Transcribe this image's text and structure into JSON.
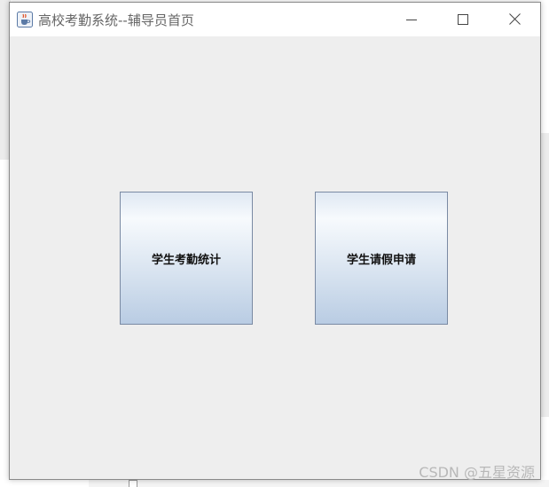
{
  "window": {
    "title": "高校考勤系统--辅导员首页",
    "app_icon": "java-cup-icon",
    "controls": {
      "minimize_icon": "minimize-icon",
      "maximize_icon": "maximize-icon",
      "close_icon": "close-icon"
    }
  },
  "main": {
    "buttons": [
      {
        "label": "学生考勤统计"
      },
      {
        "label": "学生请假申请"
      }
    ]
  },
  "watermark": "CSDN @五星资源",
  "colors": {
    "window_bg": "#eeeeee",
    "titlebar_bg": "#ffffff",
    "button_gradient_top": "#f7fafd",
    "button_gradient_bottom": "#b9cce3",
    "button_border": "#7a8aa3"
  }
}
